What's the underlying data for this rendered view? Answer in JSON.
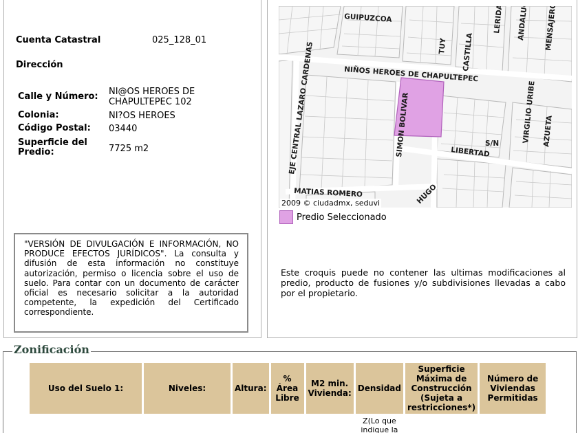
{
  "predio": {
    "cuenta_label": "Cuenta Catastral",
    "cuenta_value": "025_128_01",
    "direccion_label": "Dirección",
    "calle_label": "Calle y Número:",
    "calle_value": "NI@OS HEROES DE CHAPULTEPEC 102",
    "colonia_label": "Colonia:",
    "colonia_value": "NI?OS HEROES",
    "cp_label": "Código Postal:",
    "cp_value": "03440",
    "superficie_label": "Superficie del Predio:",
    "superficie_value": "7725 m2"
  },
  "disclaimer": "\"VERSIÓN DE DIVULGACIÓN E INFORMACIÓN, NO PRODUCE EFECTOS JURÍDICOS\". La consulta y difusión de esta información no constituye autorización, permiso o licencia sobre el uso de suelo. Para contar con un documento de carácter oficial es necesario solicitar a la autoridad competente, la expedición del Certificado correspondiente.",
  "map": {
    "credit": "2009 © ciudadmx, seduvi",
    "streets": {
      "guipuzcoa": "GUIPUZCOA",
      "tuy": "TUY",
      "castilla": "CASTILLA",
      "lerida": "LERIDA",
      "andalucia": "ANDALUCIA",
      "mensajeros": "MENSAJEROS",
      "ninos_heroes": "NIÑOS HEROES DE CHAPULTEPEC",
      "eje_central": "EJE CENTRAL LAZARO CARDENAS",
      "simon_bolivar": "SIMON BOLIVAR",
      "libertad": "LIBERTAD",
      "sn": "S/N",
      "virgilio_uribe": "VIRGILIO URIBE",
      "azueta": "AZUETA",
      "matias_romero": "MATIAS ROMERO",
      "hugo": "HUGO"
    },
    "highlight_color": "#e0a2e4"
  },
  "legend": {
    "label": "Predio Seleccionado",
    "color": "#e0a2e4"
  },
  "croquis_note": "Este croquis puede no contener las ultimas modificaciones al predio, producto de fusiones y/o subdivisiones llevadas a cabo por el propietario.",
  "zonificacion": {
    "title": "Zonificación",
    "headers": [
      "Uso del Suelo 1:",
      "Niveles:",
      "Altura:",
      "% Área Libre",
      "M2 min. Vivienda:",
      "Densidad",
      "Superficie Máxima de Construcción (Sujeta a restricciones*)",
      "Número de Viviendas Permitidas"
    ],
    "row": [
      "",
      "",
      "",
      "",
      "",
      "Z(Lo que indique la",
      "",
      ""
    ],
    "header_color": "#dbc59b"
  }
}
